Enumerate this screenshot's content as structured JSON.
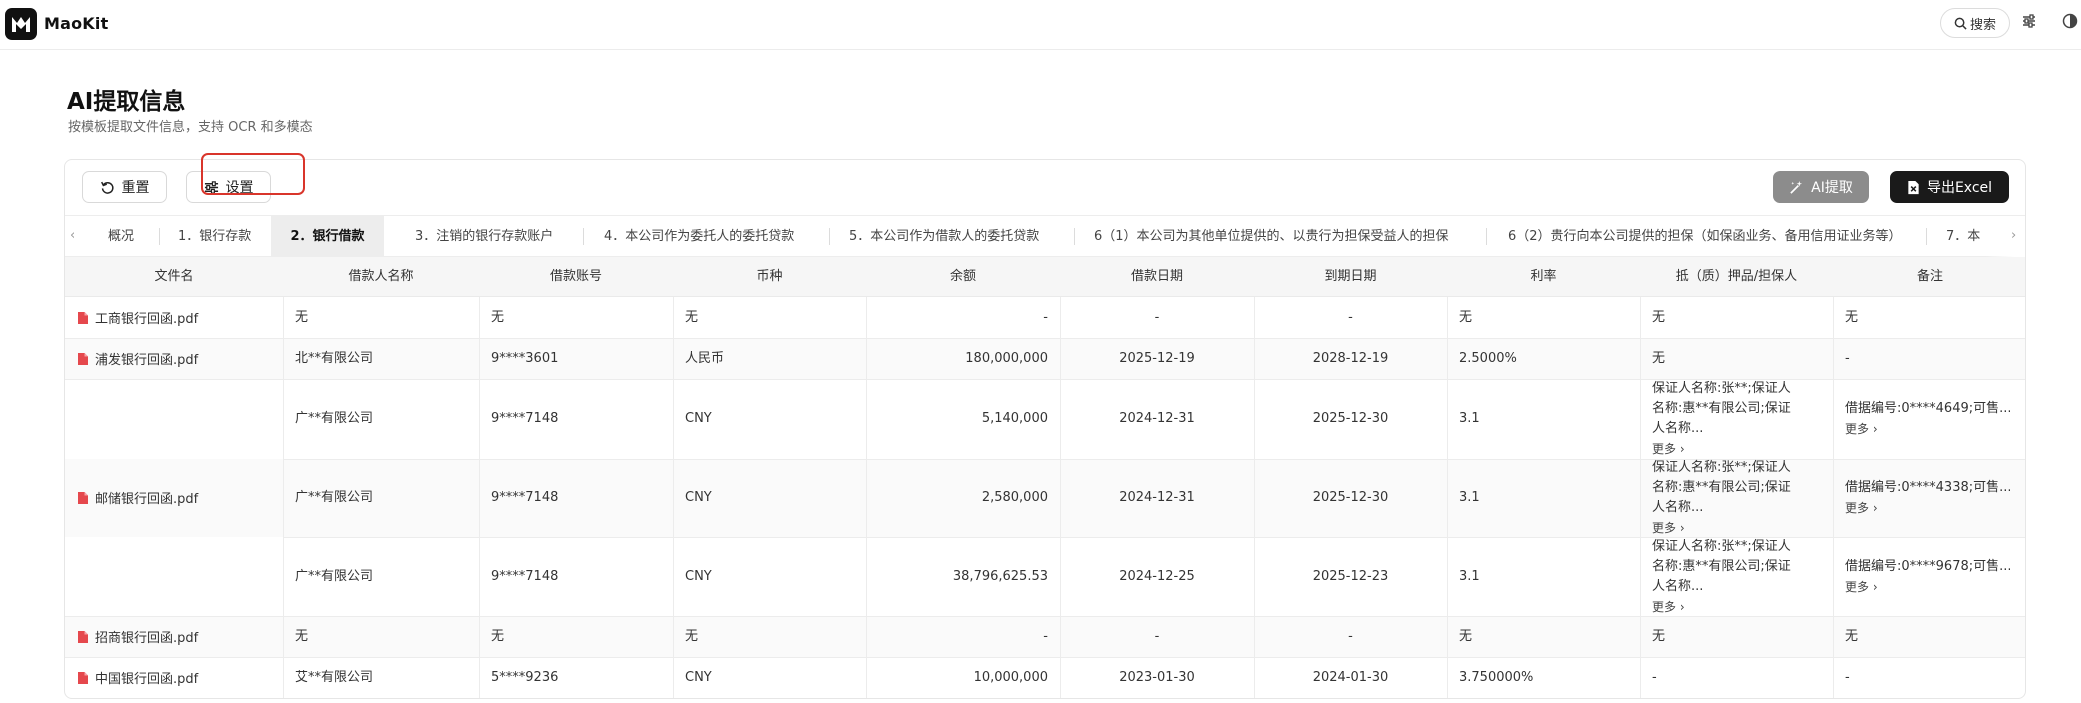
{
  "app": {
    "brand": "MaoKit"
  },
  "topbar": {
    "search_label": "搜索"
  },
  "page": {
    "title": "AI提取信息",
    "subtitle": "按模板提取文件信息，支持 OCR 和多模态"
  },
  "toolbar": {
    "reset_label": "重置",
    "settings_label": "设置",
    "ai_extract_label": "AI提取",
    "export_label": "导出Excel"
  },
  "tabs": [
    "概况",
    "1．银行存款",
    "2．银行借款",
    "3．注销的银行存款账户",
    "4．本公司作为委托人的委托贷款",
    "5．本公司作为借款人的委托贷款",
    "6（1）本公司为其他单位提供的、以贵行为担保受益人的担保",
    "6（2）贵行向本公司提供的担保（如保函业务、备用信用证业务等）",
    "7．本"
  ],
  "active_tab_index": 2,
  "table": {
    "columns": [
      "文件名",
      "借款人名称",
      "借款账号",
      "币种",
      "余额",
      "借款日期",
      "到期日期",
      "利率",
      "抵（质）押品/担保人",
      "备注"
    ],
    "files": [
      {
        "name": "工商银行回函.pdf"
      },
      {
        "name": "浦发银行回函.pdf"
      },
      {
        "name": "邮储银行回函.pdf"
      },
      {
        "name": "招商银行回函.pdf"
      },
      {
        "name": "中国银行回函.pdf"
      }
    ],
    "rows": [
      {
        "borrower": "无",
        "account": "无",
        "currency": "无",
        "balance": "-",
        "loan_date": "-",
        "due_date": "-",
        "rate": "无",
        "collateral": "无",
        "remark": "无"
      },
      {
        "borrower": "北**有限公司",
        "account": "9****3601",
        "currency": "人民币",
        "balance": "180,000,000",
        "loan_date": "2025-12-19",
        "due_date": "2028-12-19",
        "rate": "2.5000%",
        "collateral": "无",
        "remark": "-"
      },
      {
        "borrower": "广**有限公司",
        "account": "9****7148",
        "currency": "CNY",
        "balance": "5,140,000",
        "loan_date": "2024-12-31",
        "due_date": "2025-12-30",
        "rate": "3.1",
        "collateral": "保证人名称:张**;保证人名称:惠**有限公司;保证人名称...",
        "remark": "借据编号:0****4649;可售..."
      },
      {
        "borrower": "广**有限公司",
        "account": "9****7148",
        "currency": "CNY",
        "balance": "2,580,000",
        "loan_date": "2024-12-31",
        "due_date": "2025-12-30",
        "rate": "3.1",
        "collateral": "保证人名称:张**;保证人名称:惠**有限公司;保证人名称...",
        "remark": "借据编号:0****4338;可售..."
      },
      {
        "borrower": "广**有限公司",
        "account": "9****7148",
        "currency": "CNY",
        "balance": "38,796,625.53",
        "loan_date": "2024-12-25",
        "due_date": "2025-12-23",
        "rate": "3.1",
        "collateral": "保证人名称:张**;保证人名称:惠**有限公司;保证人名称...",
        "remark": "借据编号:0****9678;可售..."
      },
      {
        "borrower": "无",
        "account": "无",
        "currency": "无",
        "balance": "-",
        "loan_date": "-",
        "due_date": "-",
        "rate": "无",
        "collateral": "无",
        "remark": "无"
      },
      {
        "borrower": "艾**有限公司",
        "account": "5****9236",
        "currency": "CNY",
        "balance": "10,000,000",
        "loan_date": "2023-01-30",
        "due_date": "2024-01-30",
        "rate": "3.750000%",
        "collateral": "-",
        "remark": "-"
      }
    ],
    "more_label": "更多",
    "more_suffix": "更多 ›"
  },
  "colors": {
    "accent_dark": "#1a1a1a",
    "highlight": "#d9352b",
    "pdf_icon": "#e5484d"
  }
}
